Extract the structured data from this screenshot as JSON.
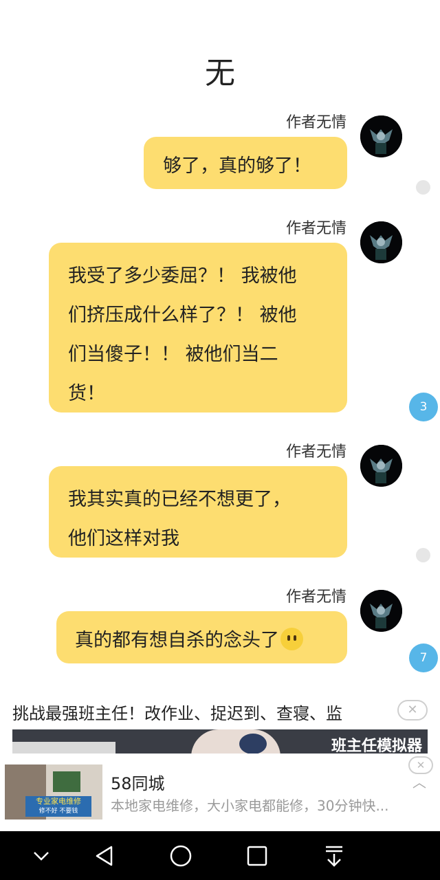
{
  "page": {
    "title": "无"
  },
  "messages": [
    {
      "author": "作者无情",
      "lines": [
        "够了，真的够了！"
      ],
      "side_indicator": "dot"
    },
    {
      "author": "作者无情",
      "lines": [
        "我受了多少委屈？！ 我被他",
        "们挤压成什么样了？！ 被他",
        "们当傻子！！ 被他们当二",
        "货！"
      ],
      "side_indicator": "badge",
      "badge_count": "3"
    },
    {
      "author": "作者无情",
      "lines": [
        "我其实真的已经不想更了，",
        "他们这样对我"
      ],
      "side_indicator": "dot"
    },
    {
      "author": "作者无情",
      "lines": [
        "真的都有想自杀的念头了"
      ],
      "emoji": "neutral-face-emoji",
      "side_indicator": "badge",
      "badge_count": "7"
    }
  ],
  "ad": {
    "text": "挑战最强班主任！改作业、捉迟到、查寝、监",
    "banner_label": "班主任模拟器",
    "close_symbol": "✕"
  },
  "notification": {
    "title": "58同城",
    "description": "本地家电维修，大小家电都能修，30分钟快...",
    "thumb_tag": "专业家电维修",
    "thumb_subtag": "修不好 不要钱",
    "close_symbol": "✕",
    "collapse_symbol": "︿"
  },
  "navbar": {
    "icons": [
      "chevron-down-icon",
      "back-icon",
      "home-icon",
      "recents-icon",
      "download-icon"
    ]
  },
  "colors": {
    "bubble": "#fddd70",
    "badge": "#57b6e8",
    "navbar": "#000000"
  }
}
